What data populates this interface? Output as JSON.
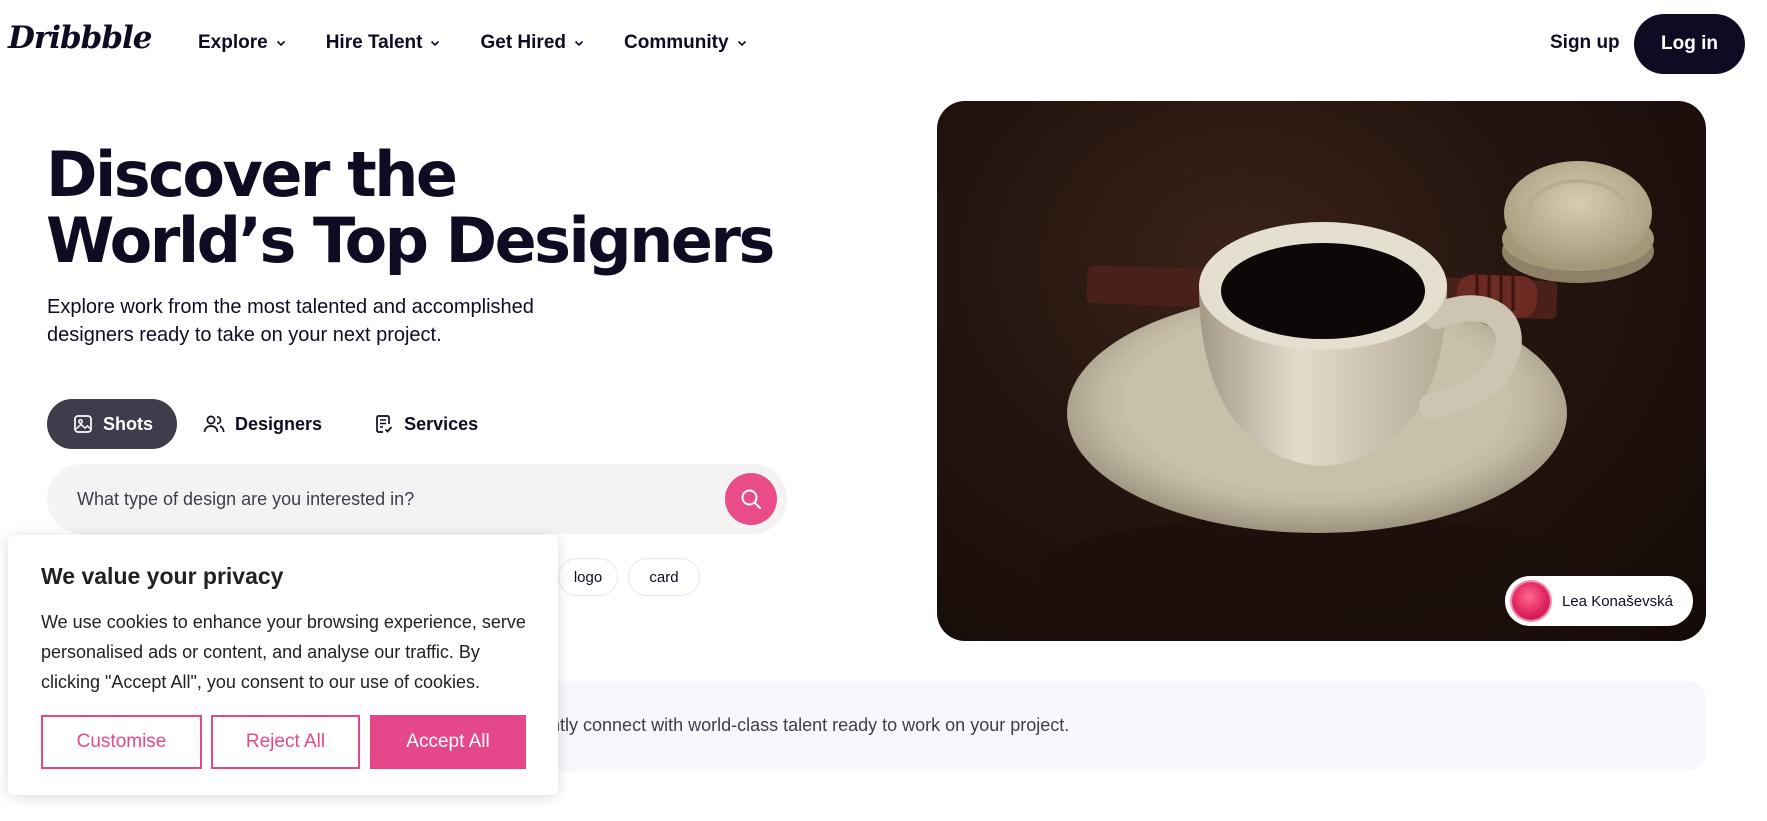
{
  "header": {
    "logo": "Dribbble",
    "nav": [
      {
        "label": "Explore"
      },
      {
        "label": "Hire Talent"
      },
      {
        "label": "Get Hired"
      },
      {
        "label": "Community"
      }
    ],
    "signup_label": "Sign up",
    "login_label": "Log in"
  },
  "hero": {
    "title_line1": "Discover the",
    "title_line2": "World’s Top Designers",
    "subtitle": "Explore work from the most talented and accomplished designers ready to take on your next project."
  },
  "tabs": [
    {
      "label": "Shots",
      "icon": "image-icon",
      "active": true
    },
    {
      "label": "Designers",
      "icon": "users-icon",
      "active": false
    },
    {
      "label": "Services",
      "icon": "document-check-icon",
      "active": false
    }
  ],
  "search": {
    "placeholder": "What type of design are you interested in?",
    "button_icon": "search-icon"
  },
  "tags": [
    "logo",
    "card"
  ],
  "shot": {
    "author_name": "Lea Konaševská"
  },
  "banner": {
    "text": "antly connect with world-class talent ready to work on your project."
  },
  "cookie": {
    "title": "We value your privacy",
    "body": "We use cookies to enhance your browsing experience, serve personalised ads or content, and analyse our traffic. By clicking \"Accept All\", you consent to our use of cookies.",
    "customise_label": "Customise",
    "reject_label": "Reject All",
    "accept_label": "Accept All"
  },
  "colors": {
    "brand_pink": "#ea4c89",
    "dark": "#0d0c22",
    "tab_active": "#3d3d4e",
    "cookie_accent": "#e5488a"
  }
}
